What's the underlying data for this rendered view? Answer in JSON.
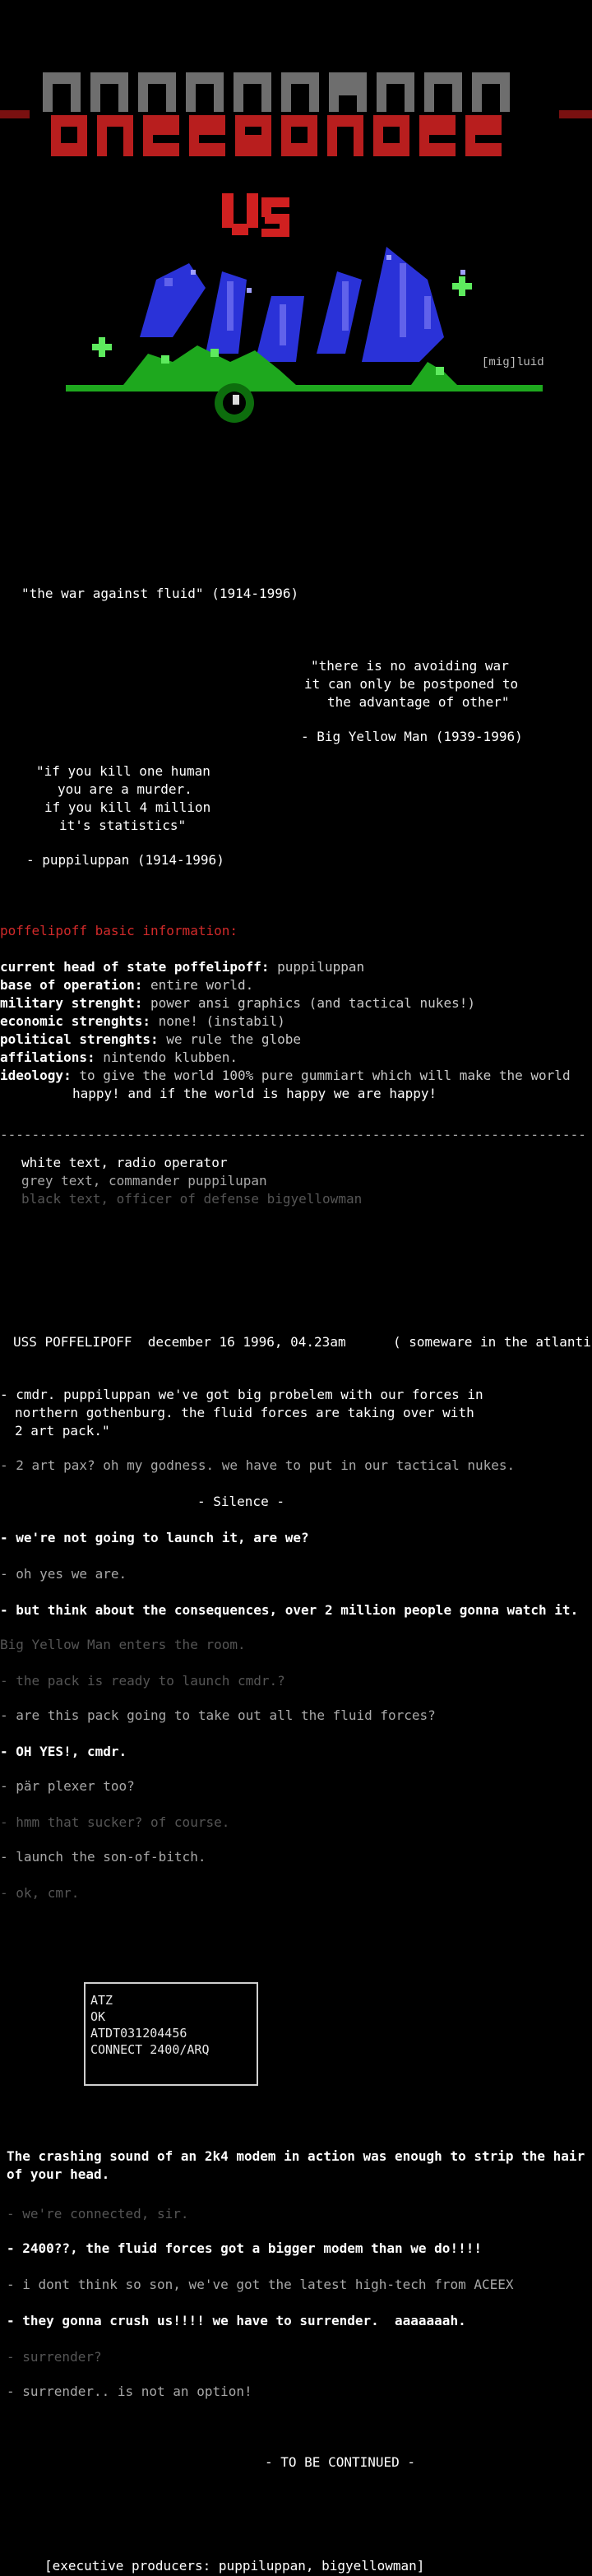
{
  "logo": {
    "top_word": "POFFELIPOFF",
    "bottom_word": "PUFFELIPUFF",
    "vs": "VS",
    "fluid": "fluid",
    "signature": "[mig]luid"
  },
  "colors": {
    "red_heading": "#d22a2a",
    "white": "#ffffff",
    "grey": "#a8a8a8",
    "dark": "#555555"
  },
  "intro": {
    "title": "\"the war against fluid\" (1914-1996)",
    "quote1_l1": "\"there is no avoiding war",
    "quote1_l2": "it can only be postponed to",
    "quote1_l3": "the advantage of other\"",
    "quote1_by": "- Big Yellow Man (1939-1996)",
    "quote2_l1": "\"if you kill one human",
    "quote2_l2": "you are a murder.",
    "quote2_l3": "if you kill 4 million",
    "quote2_l4": "it's statistics\"",
    "quote2_by": "- puppiluppan (1914-1996)"
  },
  "info": {
    "heading": "poffelipoff basic information:",
    "rows": [
      {
        "key": "current head of state poffelipoff:",
        "val": " puppiluppan"
      },
      {
        "key": "base of operation:",
        "val": " entire world."
      },
      {
        "key": "military strenght:",
        "val": " power ansi graphics (and tactical nukes!)"
      },
      {
        "key": "economic strenghts:",
        "val": " none! (instabil)"
      },
      {
        "key": "political strenghts:",
        "val": " we rule the globe"
      },
      {
        "key": "affilations:",
        "val": " nintendo klubben."
      },
      {
        "key": "ideology:",
        "val": " to give the world 100% pure gummiart which will make the world"
      }
    ],
    "ideology_cont": "happy! and if the world is happy we are happy!"
  },
  "divider": "------------------------------------------------------------------------------------------------------------------",
  "legend": {
    "white": "white text, radio operator",
    "grey": "grey text, commander puppilupan",
    "black": "black text, officer of defense bigyellowman"
  },
  "scene": {
    "header": "USS POFFELIPOFF  december 16 1996, 04.23am",
    "location": "( someware in the atlantic )",
    "l1": "- cmdr. puppiluppan we've got big probelem with our forces in",
    "l2": "northern gothenburg. the fluid forces are taking over with",
    "l3": "2 art pack.\"",
    "l4": "- 2 art pax? oh my godness. we have to put in our tactical nukes.",
    "silence": "- Silence -",
    "l5": "- we're not going to launch it, are we?",
    "l6": "- oh yes we are.",
    "l7": "- but think about the consequences, over 2 million people gonna watch it.",
    "l8": "Big Yellow Man enters the room.",
    "l9": "- the pack is ready to launch cmdr.?",
    "l10": "- are this pack going to take out all the fluid forces?",
    "l11": "- OH YES!, cmdr.",
    "l12": "- pär plexer too?",
    "l13": "- hmm that sucker? of course.",
    "l14": "- launch the son-of-bitch.",
    "l15": "- ok, cmr."
  },
  "modem": {
    "line1": "ATZ",
    "line2": "OK",
    "line3": "ATDT031204456",
    "line4": "CONNECT 2400/ARQ"
  },
  "ending": {
    "p1": "The crashing sound of an 2k4 modem in action was enough to strip the hair",
    "p2": "of your head.",
    "e1": "- we're connected, sir.",
    "e2": "- 2400??, the fluid forces got a bigger modem than we do!!!!",
    "e3": "- i dont think so son, we've got the latest high-tech from ACEEX",
    "e4": "- they gonna crush us!!!! we have to surrender.  aaaaaaah.",
    "e5": "- surrender?",
    "e6": "- surrender.. is not an option!",
    "continued": "- TO BE CONTINUED -",
    "credits": "[executive producers: puppiluppan, bigyellowman]"
  }
}
